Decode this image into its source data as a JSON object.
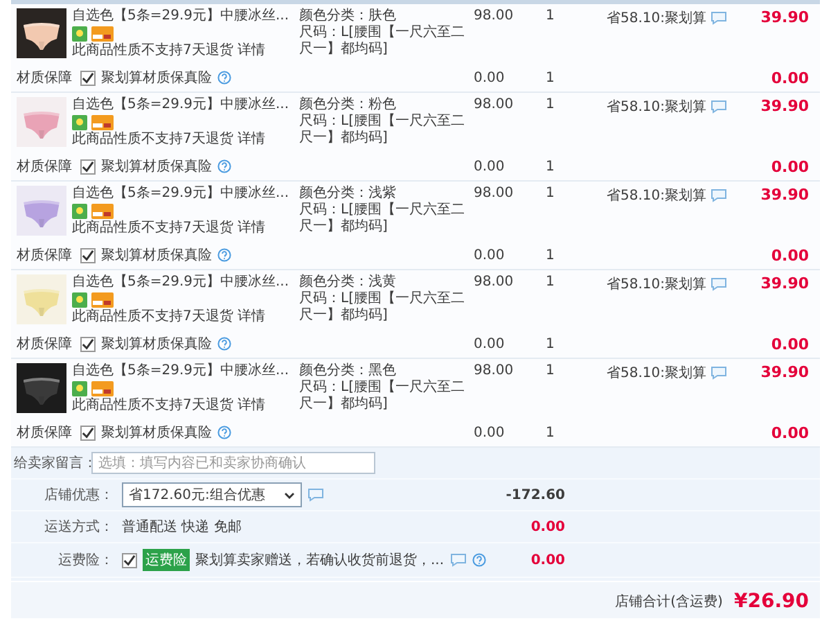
{
  "items": [
    {
      "title": "自选色【5条=29.9元】中腰冰丝...",
      "return_note": "此商品性质不支持7天退货",
      "detail_link": "详情",
      "sku_color": "颜色分类：肤色",
      "sku_size": "尺码：L[腰围【一尺六至二尺一】都均码]",
      "price": "98.00",
      "quantity": "1",
      "savings": "省58.10:聚划算",
      "total": "39.90",
      "insurance": {
        "label": "材质保障",
        "checked": true,
        "name": "聚划算材质保真险",
        "price": "0.00",
        "quantity": "1",
        "total": "0.00"
      }
    },
    {
      "title": "自选色【5条=29.9元】中腰冰丝...",
      "return_note": "此商品性质不支持7天退货",
      "detail_link": "详情",
      "sku_color": "颜色分类：粉色",
      "sku_size": "尺码：L[腰围【一尺六至二尺一】都均码]",
      "price": "98.00",
      "quantity": "1",
      "savings": "省58.10:聚划算",
      "total": "39.90",
      "insurance": {
        "label": "材质保障",
        "checked": true,
        "name": "聚划算材质保真险",
        "price": "0.00",
        "quantity": "1",
        "total": "0.00"
      }
    },
    {
      "title": "自选色【5条=29.9元】中腰冰丝...",
      "return_note": "此商品性质不支持7天退货",
      "detail_link": "详情",
      "sku_color": "颜色分类：浅紫",
      "sku_size": "尺码：L[腰围【一尺六至二尺一】都均码]",
      "price": "98.00",
      "quantity": "1",
      "savings": "省58.10:聚划算",
      "total": "39.90",
      "insurance": {
        "label": "材质保障",
        "checked": true,
        "name": "聚划算材质保真险",
        "price": "0.00",
        "quantity": "1",
        "total": "0.00"
      }
    },
    {
      "title": "自选色【5条=29.9元】中腰冰丝...",
      "return_note": "此商品性质不支持7天退货",
      "detail_link": "详情",
      "sku_color": "颜色分类：浅黄",
      "sku_size": "尺码：L[腰围【一尺六至二尺一】都均码]",
      "price": "98.00",
      "quantity": "1",
      "savings": "省58.10:聚划算",
      "total": "39.90",
      "insurance": {
        "label": "材质保障",
        "checked": true,
        "name": "聚划算材质保真险",
        "price": "0.00",
        "quantity": "1",
        "total": "0.00"
      }
    },
    {
      "title": "自选色【5条=29.9元】中腰冰丝...",
      "return_note": "此商品性质不支持7天退货",
      "detail_link": "详情",
      "sku_color": "颜色分类：黑色",
      "sku_size": "尺码：L[腰围【一尺六至二尺一】都均码]",
      "price": "98.00",
      "quantity": "1",
      "savings": "省58.10:聚划算",
      "total": "39.90",
      "insurance": {
        "label": "材质保障",
        "checked": true,
        "name": "聚划算材质保真险",
        "price": "0.00",
        "quantity": "1",
        "total": "0.00"
      }
    }
  ],
  "message": {
    "label": "给卖家留言：",
    "placeholder": "选填：填写内容已和卖家协商确认"
  },
  "discount": {
    "label": "店铺优惠：",
    "selection": "省172.60元:组合优惠",
    "value": "-172.60"
  },
  "delivery": {
    "label": "运送方式：",
    "method": "普通配送 快递 免邮",
    "value": "0.00"
  },
  "shipping_insurance": {
    "label": "运费险：",
    "checked": true,
    "badge": "运费险",
    "text": "聚划算卖家赠送，若确认收货前退货，...",
    "value": "0.00"
  },
  "store_total": {
    "label": "店铺合计(含运费)",
    "amount": "¥26.90"
  }
}
